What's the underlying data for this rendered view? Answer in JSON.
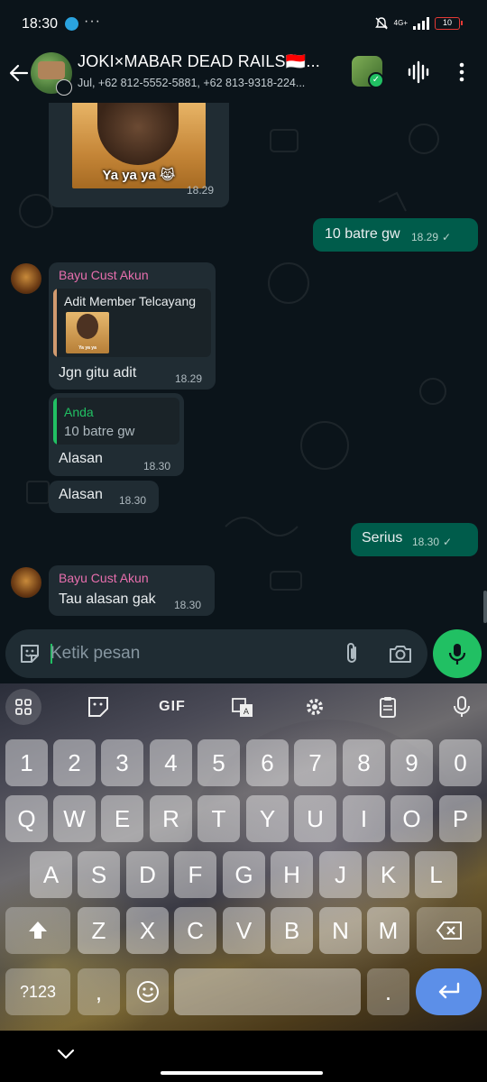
{
  "status_bar": {
    "time": "18:30",
    "network": "4G+",
    "battery": "10"
  },
  "header": {
    "title": "JOKI×MABAR DEAD RAILS🇮🇩...",
    "subtitle": "Jul, +62 812-5552-5881, +62 813-9318-224..."
  },
  "messages": {
    "sticker_caption": "Ya ya ya 😹",
    "sticker_time": "18.29",
    "out1_text": "10 batre gw",
    "out1_time": "18.29",
    "in1_sender": "Bayu Cust Akun",
    "in1_quote_name": "Adit Member Telcayang",
    "in1_quote_thumb": "Ya ya ya",
    "in1_text": "Jgn gitu adit",
    "in1_time": "18.29",
    "in2_quote_name": "Anda",
    "in2_quote_text": "10 batre gw",
    "in2_text": "Alasan",
    "in2_time": "18.30",
    "in3_text": "Alasan",
    "in3_time": "18.30",
    "out2_text": "Serius",
    "out2_time": "18.30",
    "in4_sender": "Bayu Cust Akun",
    "in4_text": "Tau alasan gak",
    "in4_time": "18.30"
  },
  "composer": {
    "placeholder": "Ketik pesan"
  },
  "keyboard": {
    "toolbar_gif": "GIF",
    "row_numbers": [
      "1",
      "2",
      "3",
      "4",
      "5",
      "6",
      "7",
      "8",
      "9",
      "0"
    ],
    "row1": [
      "Q",
      "W",
      "E",
      "R",
      "T",
      "Y",
      "U",
      "I",
      "O",
      "P"
    ],
    "row2": [
      "A",
      "S",
      "D",
      "F",
      "G",
      "H",
      "J",
      "K",
      "L"
    ],
    "row3": [
      "Z",
      "X",
      "C",
      "V",
      "B",
      "N",
      "M"
    ],
    "symbols_key": "?123",
    "comma_key": ",",
    "period_key": "."
  },
  "colors": {
    "accent": "#21c063",
    "outgoing_bubble": "#005c4b",
    "incoming_bubble": "#202c33",
    "sender_name": "#e86fae",
    "quote_you": "#21c063",
    "quote_other": "#d19a6f",
    "quote_other_name": "#e9edef"
  }
}
